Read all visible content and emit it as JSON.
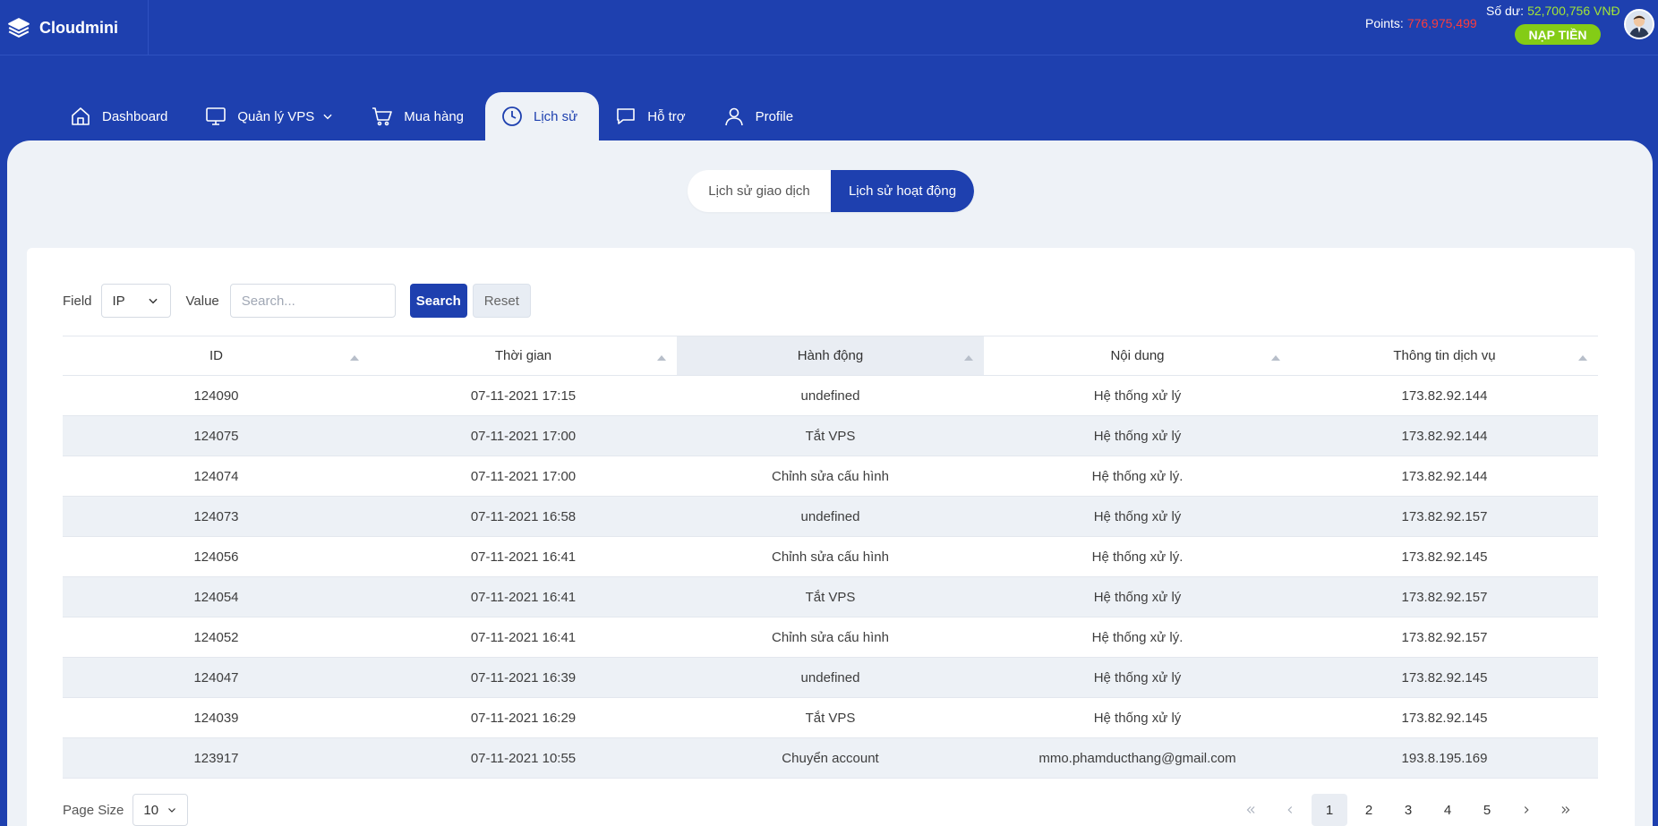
{
  "app": {
    "name": "Cloudmini"
  },
  "account": {
    "points_label": "Points:",
    "points_value": "776,975,499",
    "balance_label": "Số dư:",
    "balance_value": "52,700,756 VNĐ",
    "topup_label": "NẠP TIỀN"
  },
  "nav": {
    "items": [
      {
        "label": "Dashboard",
        "icon": "home-icon"
      },
      {
        "label": "Quản lý VPS",
        "icon": "monitor-icon"
      },
      {
        "label": "Mua hàng",
        "icon": "cart-icon"
      },
      {
        "label": "Lịch sử",
        "icon": "clock-icon",
        "active": true
      },
      {
        "label": "Hỗ trợ",
        "icon": "chat-icon"
      },
      {
        "label": "Profile",
        "icon": "user-icon"
      }
    ]
  },
  "tabs": [
    {
      "label": "Lịch sử giao dịch"
    },
    {
      "label": "Lịch sử hoạt động",
      "active": true
    }
  ],
  "filter": {
    "field_label": "Field",
    "field_value": "IP",
    "value_label": "Value",
    "search_placeholder": "Search...",
    "search_button": "Search",
    "reset_button": "Reset"
  },
  "table": {
    "columns": [
      "ID",
      "Thời gian",
      "Hành động",
      "Nội dung",
      "Thông tin dịch vụ"
    ],
    "rows": [
      [
        "124090",
        "07-11-2021 17:15",
        "undefined",
        "Hệ thống xử lý",
        "173.82.92.144"
      ],
      [
        "124075",
        "07-11-2021 17:00",
        "Tắt VPS",
        "Hệ thống xử lý",
        "173.82.92.144"
      ],
      [
        "124074",
        "07-11-2021 17:00",
        "Chỉnh sửa cấu hình",
        "Hệ thống xử lý.",
        "173.82.92.144"
      ],
      [
        "124073",
        "07-11-2021 16:58",
        "undefined",
        "Hệ thống xử lý",
        "173.82.92.157"
      ],
      [
        "124056",
        "07-11-2021 16:41",
        "Chỉnh sửa cấu hình",
        "Hệ thống xử lý.",
        "173.82.92.145"
      ],
      [
        "124054",
        "07-11-2021 16:41",
        "Tắt VPS",
        "Hệ thống xử lý",
        "173.82.92.157"
      ],
      [
        "124052",
        "07-11-2021 16:41",
        "Chỉnh sửa cấu hình",
        "Hệ thống xử lý.",
        "173.82.92.157"
      ],
      [
        "124047",
        "07-11-2021 16:39",
        "undefined",
        "Hệ thống xử lý",
        "173.82.92.145"
      ],
      [
        "124039",
        "07-11-2021 16:29",
        "Tắt VPS",
        "Hệ thống xử lý",
        "173.82.92.145"
      ],
      [
        "123917",
        "07-11-2021 10:55",
        "Chuyển account",
        "mmo.phamducthang@gmail.com",
        "193.8.195.169"
      ]
    ]
  },
  "pagination": {
    "page_size_label": "Page Size",
    "page_size_value": "10",
    "pages": [
      "1",
      "2",
      "3",
      "4",
      "5"
    ],
    "current_page": "1"
  }
}
